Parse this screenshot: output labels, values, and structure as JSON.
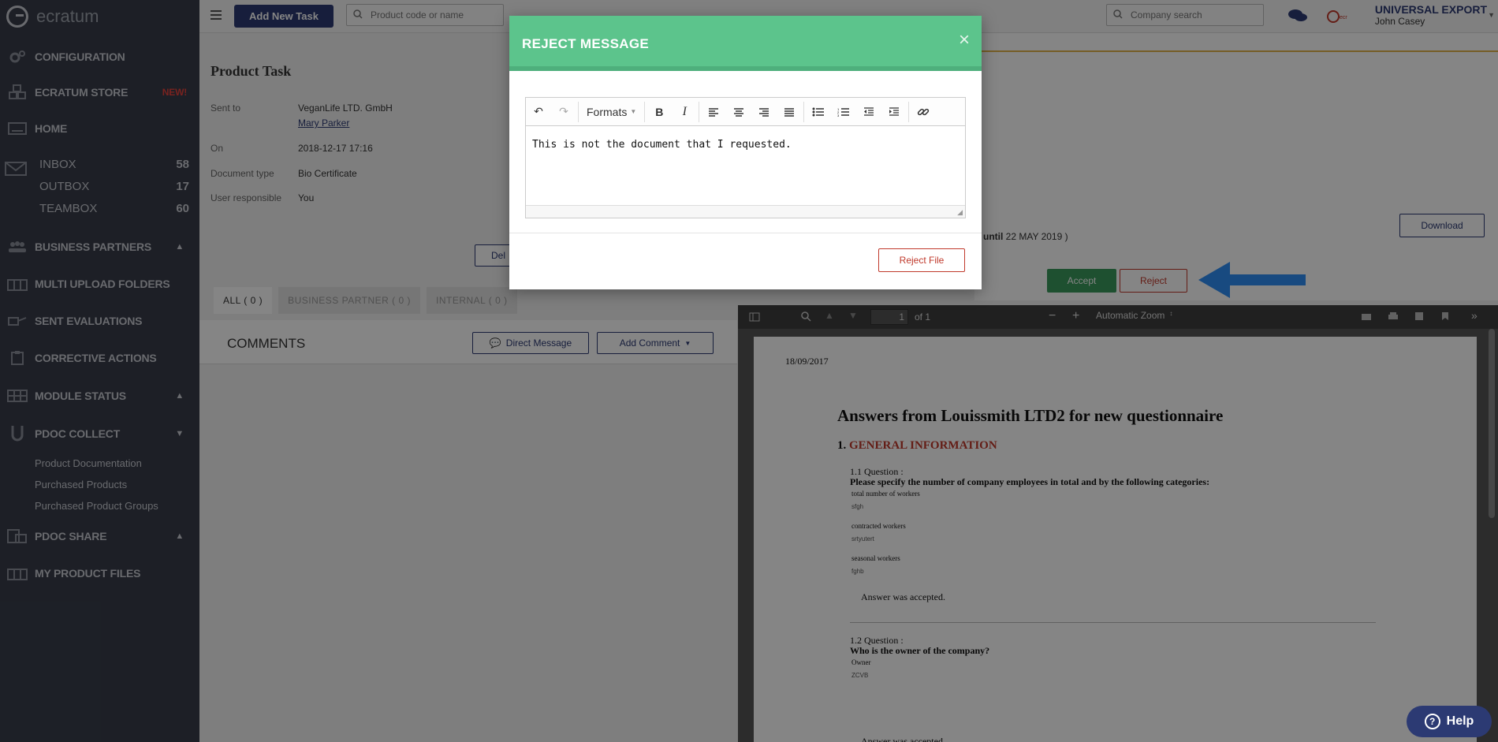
{
  "app": {
    "logo_text": "ecratum"
  },
  "sidebar": {
    "configuration": "CONFIGURATION",
    "store": "ECRATUM STORE",
    "store_badge": "NEW!",
    "home": "HOME",
    "inbox": {
      "label": "INBOX",
      "count": "58"
    },
    "outbox": {
      "label": "OUTBOX",
      "count": "17"
    },
    "teambox": {
      "label": "TEAMBOX",
      "count": "60"
    },
    "business_partners": "BUSINESS PARTNERS",
    "multi_upload": "MULTI UPLOAD FOLDERS",
    "sent_evaluations": "SENT EVALUATIONS",
    "corrective_actions": "CORRECTIVE ACTIONS",
    "module_status": "MODULE STATUS",
    "pdoc_collect": "PDOC COLLECT",
    "pdoc_items": [
      "Product Documentation",
      "Purchased Products",
      "Purchased Product Groups"
    ],
    "pdoc_share": "PDOC SHARE",
    "my_product_files": "MY PRODUCT FILES"
  },
  "topbar": {
    "add_task": "Add New Task",
    "product_search_placeholder": "Product code or name",
    "company_search_placeholder": "Company search",
    "company_name": "UNIVERSAL EXPORT",
    "user_name": "John Casey"
  },
  "task": {
    "title": "Product Task",
    "sent_to_label": "Sent to",
    "sent_to_value": "VeganLife LTD. GmbH",
    "sent_to_person": "Mary Parker",
    "on_label": "On",
    "on_value": "2018-12-17 17:16",
    "doctype_label": "Document type",
    "doctype_value": "Bio Certificate",
    "user_label": "User responsible",
    "user_value": "You",
    "del_button": "Del"
  },
  "tabs": [
    "ALL ( 0 )",
    "BUSINESS PARTNER ( 0 )",
    "INTERNAL ( 0 )"
  ],
  "comments": {
    "title": "COMMENTS",
    "direct_message": "Direct Message",
    "add_comment": "Add Comment"
  },
  "file": {
    "until_prefix": "until",
    "until_date": "22 MAY 2019 )",
    "download": "Download",
    "accept": "Accept",
    "reject": "Reject"
  },
  "pdf": {
    "page_value": "1",
    "page_of": "of 1",
    "zoom": "Automatic Zoom",
    "date": "18/09/2017",
    "heading": "Answers from Louissmith LTD2 for new questionnaire",
    "section_num": "1.",
    "section": "GENERAL INFORMATION",
    "q1_label": "1.1 Question :",
    "q1_text": "Please specify the number of company employees in total and by the following categories:",
    "q1_items": [
      [
        "total number of workers",
        "sfgh"
      ],
      [
        "contracted workers",
        "srtyutert"
      ],
      [
        "seasonal workers",
        "fghb"
      ]
    ],
    "accepted": "Answer was accepted.",
    "q2_label": "1.2 Question :",
    "q2_text": "Who is the owner of the company?",
    "q2_item": [
      "Owner",
      "ZCVB"
    ]
  },
  "modal": {
    "title": "REJECT MESSAGE",
    "formats": "Formats",
    "message": "This is not the document that I requested.",
    "reject_file": "Reject File"
  },
  "help": "Help"
}
